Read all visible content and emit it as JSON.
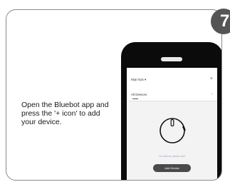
{
  "step": {
    "number": "7"
  },
  "instruction": {
    "text": "Open the Bluebot app and press the '+ icon' to add your device."
  },
  "app": {
    "home_title": "Mijn huis ▾",
    "add_icon": "+",
    "devices_tab": "All Devices",
    "more_icon": "···",
    "empty_text": "No devices, please add",
    "add_device_label": "Add Device"
  },
  "colors": {
    "badge": "#555555",
    "border": "#8a8a8a",
    "phone": "#0b0b0b",
    "button": "#4a4a4a"
  }
}
